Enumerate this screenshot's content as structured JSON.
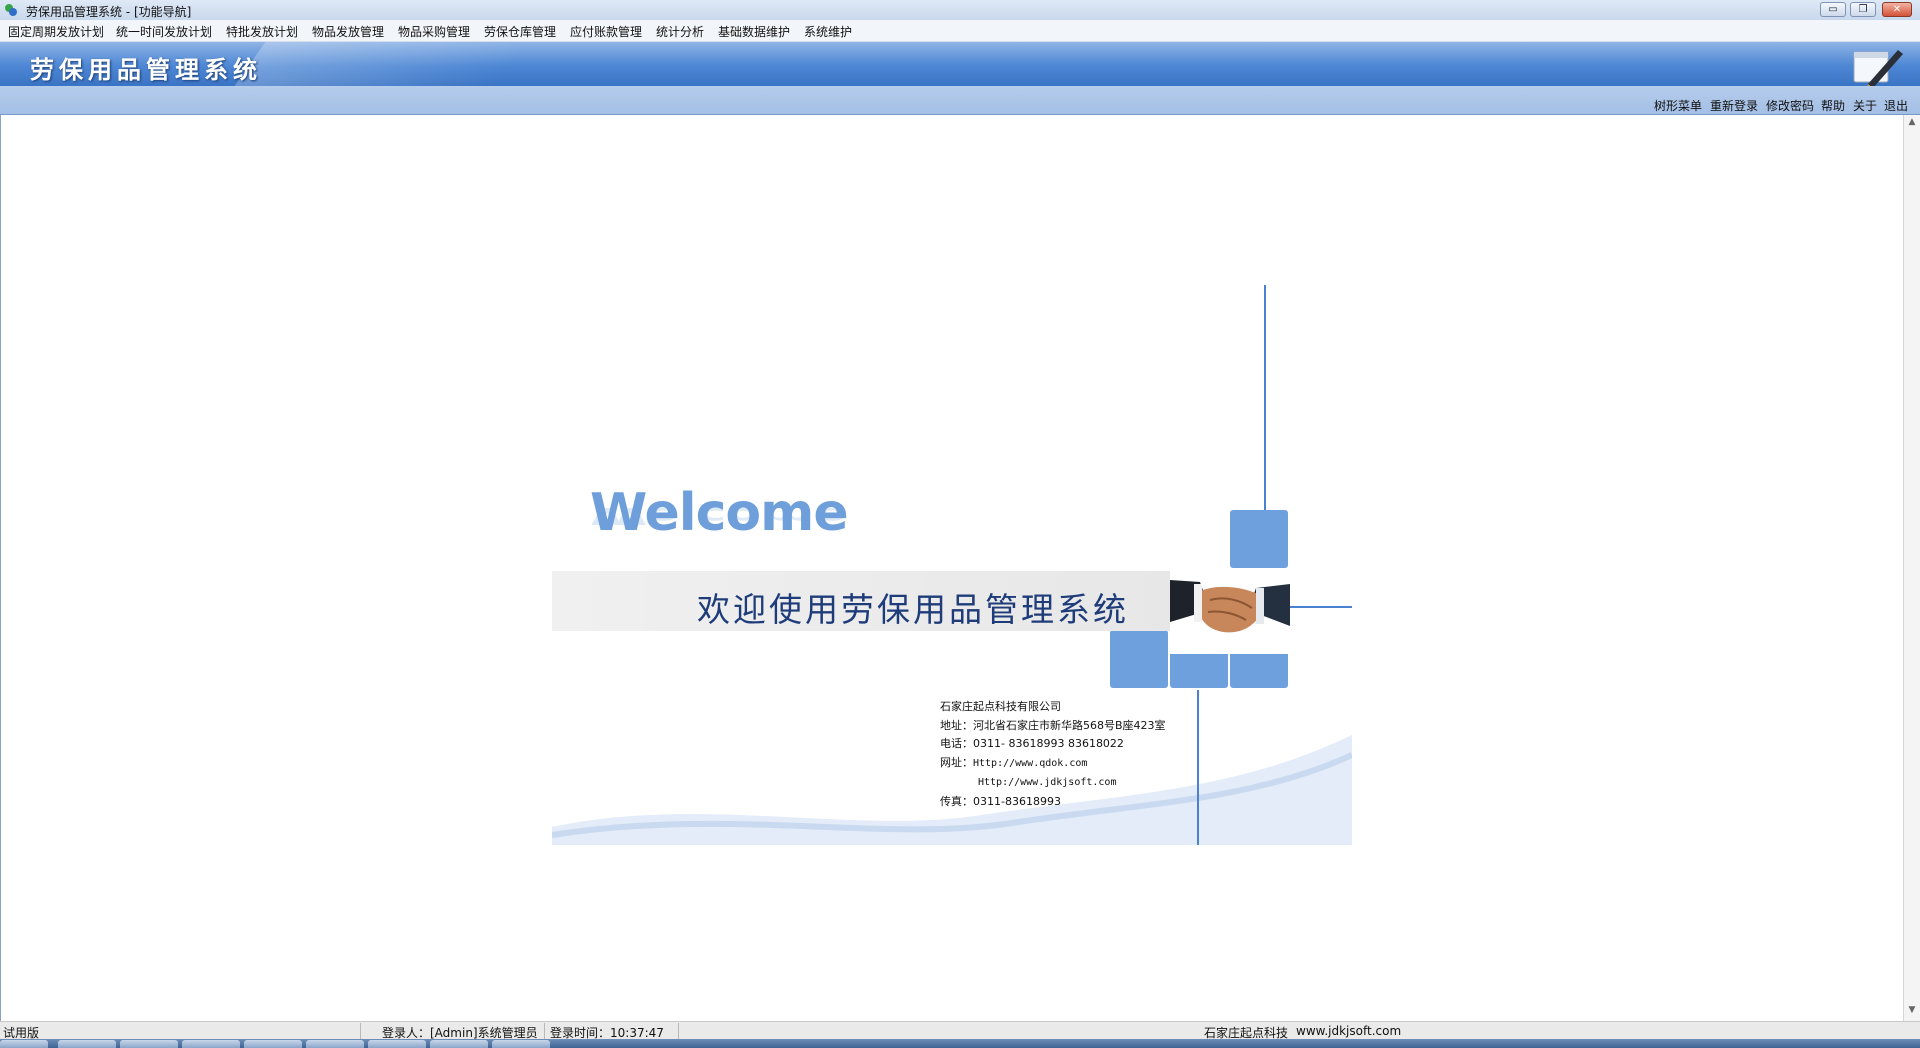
{
  "window": {
    "title": "劳保用品管理系统 - [功能导航]",
    "controls": {
      "minimize": "▭",
      "restore": "❐",
      "close": "✕"
    }
  },
  "menu": [
    "固定周期发放计划",
    "统一时间发放计划",
    "特批发放计划",
    "物品发放管理",
    "物品采购管理",
    "劳保仓库管理",
    "应付账款管理",
    "统计分析",
    "基础数据维护",
    "系统维护"
  ],
  "banner": {
    "title": "劳保用品管理系统",
    "icon": "pen-notepad-icon"
  },
  "toolbar": [
    "树形菜单",
    "重新登录",
    "修改密码",
    "帮助",
    "关于",
    "退出"
  ],
  "welcome": {
    "heading": "Welcome",
    "greeting": "欢迎使用劳保用品管理系统",
    "company": "石家庄起点科技有限公司",
    "address": "地址：河北省石家庄市新华路568号B座423室",
    "phone": "电话：0311- 83618993  83618022",
    "web_label": "网址：",
    "web1": "Http://www.qdok.com",
    "web2": "Http://www.jdkjsoft.com",
    "fax": "传真：0311-83618993"
  },
  "status": {
    "mode": "试用版",
    "login_user": "登录人：[Admin]系统管理员",
    "login_time": "登录时间：10:37:47",
    "vendor": "石家庄起点科技",
    "vendor_url": "www.jdkjsoft.com"
  },
  "colors": {
    "accent": "#4a82cf",
    "banner": "#4c86d4",
    "tile": "#6fa0de",
    "greeting_text": "#1f3c7a"
  }
}
